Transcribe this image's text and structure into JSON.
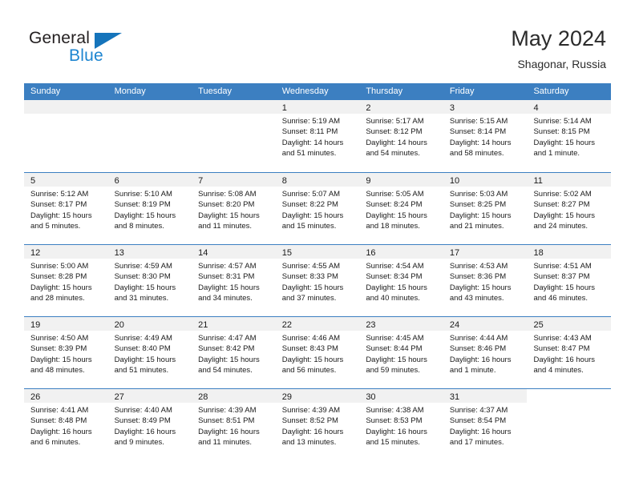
{
  "brand": {
    "name_dark": "General",
    "name_blue": "Blue",
    "accent_blue": "#1d85d0",
    "triangle_blue": "#1574bb"
  },
  "header": {
    "title": "May 2024",
    "subtitle": "Shagonar, Russia"
  },
  "calendar": {
    "header_bg": "#3c7fc1",
    "daynum_bg": "#f1f1f1",
    "weekdays": [
      "Sunday",
      "Monday",
      "Tuesday",
      "Wednesday",
      "Thursday",
      "Friday",
      "Saturday"
    ],
    "weeks": [
      [
        {
          "day": "",
          "blank": true
        },
        {
          "day": "",
          "blank": true
        },
        {
          "day": "",
          "blank": true
        },
        {
          "day": "1",
          "sunrise": "Sunrise: 5:19 AM",
          "sunset": "Sunset: 8:11 PM",
          "daylight": "Daylight: 14 hours and 51 minutes."
        },
        {
          "day": "2",
          "sunrise": "Sunrise: 5:17 AM",
          "sunset": "Sunset: 8:12 PM",
          "daylight": "Daylight: 14 hours and 54 minutes."
        },
        {
          "day": "3",
          "sunrise": "Sunrise: 5:15 AM",
          "sunset": "Sunset: 8:14 PM",
          "daylight": "Daylight: 14 hours and 58 minutes."
        },
        {
          "day": "4",
          "sunrise": "Sunrise: 5:14 AM",
          "sunset": "Sunset: 8:15 PM",
          "daylight": "Daylight: 15 hours and 1 minute."
        }
      ],
      [
        {
          "day": "5",
          "sunrise": "Sunrise: 5:12 AM",
          "sunset": "Sunset: 8:17 PM",
          "daylight": "Daylight: 15 hours and 5 minutes."
        },
        {
          "day": "6",
          "sunrise": "Sunrise: 5:10 AM",
          "sunset": "Sunset: 8:19 PM",
          "daylight": "Daylight: 15 hours and 8 minutes."
        },
        {
          "day": "7",
          "sunrise": "Sunrise: 5:08 AM",
          "sunset": "Sunset: 8:20 PM",
          "daylight": "Daylight: 15 hours and 11 minutes."
        },
        {
          "day": "8",
          "sunrise": "Sunrise: 5:07 AM",
          "sunset": "Sunset: 8:22 PM",
          "daylight": "Daylight: 15 hours and 15 minutes."
        },
        {
          "day": "9",
          "sunrise": "Sunrise: 5:05 AM",
          "sunset": "Sunset: 8:24 PM",
          "daylight": "Daylight: 15 hours and 18 minutes."
        },
        {
          "day": "10",
          "sunrise": "Sunrise: 5:03 AM",
          "sunset": "Sunset: 8:25 PM",
          "daylight": "Daylight: 15 hours and 21 minutes."
        },
        {
          "day": "11",
          "sunrise": "Sunrise: 5:02 AM",
          "sunset": "Sunset: 8:27 PM",
          "daylight": "Daylight: 15 hours and 24 minutes."
        }
      ],
      [
        {
          "day": "12",
          "sunrise": "Sunrise: 5:00 AM",
          "sunset": "Sunset: 8:28 PM",
          "daylight": "Daylight: 15 hours and 28 minutes."
        },
        {
          "day": "13",
          "sunrise": "Sunrise: 4:59 AM",
          "sunset": "Sunset: 8:30 PM",
          "daylight": "Daylight: 15 hours and 31 minutes."
        },
        {
          "day": "14",
          "sunrise": "Sunrise: 4:57 AM",
          "sunset": "Sunset: 8:31 PM",
          "daylight": "Daylight: 15 hours and 34 minutes."
        },
        {
          "day": "15",
          "sunrise": "Sunrise: 4:55 AM",
          "sunset": "Sunset: 8:33 PM",
          "daylight": "Daylight: 15 hours and 37 minutes."
        },
        {
          "day": "16",
          "sunrise": "Sunrise: 4:54 AM",
          "sunset": "Sunset: 8:34 PM",
          "daylight": "Daylight: 15 hours and 40 minutes."
        },
        {
          "day": "17",
          "sunrise": "Sunrise: 4:53 AM",
          "sunset": "Sunset: 8:36 PM",
          "daylight": "Daylight: 15 hours and 43 minutes."
        },
        {
          "day": "18",
          "sunrise": "Sunrise: 4:51 AM",
          "sunset": "Sunset: 8:37 PM",
          "daylight": "Daylight: 15 hours and 46 minutes."
        }
      ],
      [
        {
          "day": "19",
          "sunrise": "Sunrise: 4:50 AM",
          "sunset": "Sunset: 8:39 PM",
          "daylight": "Daylight: 15 hours and 48 minutes."
        },
        {
          "day": "20",
          "sunrise": "Sunrise: 4:49 AM",
          "sunset": "Sunset: 8:40 PM",
          "daylight": "Daylight: 15 hours and 51 minutes."
        },
        {
          "day": "21",
          "sunrise": "Sunrise: 4:47 AM",
          "sunset": "Sunset: 8:42 PM",
          "daylight": "Daylight: 15 hours and 54 minutes."
        },
        {
          "day": "22",
          "sunrise": "Sunrise: 4:46 AM",
          "sunset": "Sunset: 8:43 PM",
          "daylight": "Daylight: 15 hours and 56 minutes."
        },
        {
          "day": "23",
          "sunrise": "Sunrise: 4:45 AM",
          "sunset": "Sunset: 8:44 PM",
          "daylight": "Daylight: 15 hours and 59 minutes."
        },
        {
          "day": "24",
          "sunrise": "Sunrise: 4:44 AM",
          "sunset": "Sunset: 8:46 PM",
          "daylight": "Daylight: 16 hours and 1 minute."
        },
        {
          "day": "25",
          "sunrise": "Sunrise: 4:43 AM",
          "sunset": "Sunset: 8:47 PM",
          "daylight": "Daylight: 16 hours and 4 minutes."
        }
      ],
      [
        {
          "day": "26",
          "sunrise": "Sunrise: 4:41 AM",
          "sunset": "Sunset: 8:48 PM",
          "daylight": "Daylight: 16 hours and 6 minutes."
        },
        {
          "day": "27",
          "sunrise": "Sunrise: 4:40 AM",
          "sunset": "Sunset: 8:49 PM",
          "daylight": "Daylight: 16 hours and 9 minutes."
        },
        {
          "day": "28",
          "sunrise": "Sunrise: 4:39 AM",
          "sunset": "Sunset: 8:51 PM",
          "daylight": "Daylight: 16 hours and 11 minutes."
        },
        {
          "day": "29",
          "sunrise": "Sunrise: 4:39 AM",
          "sunset": "Sunset: 8:52 PM",
          "daylight": "Daylight: 16 hours and 13 minutes."
        },
        {
          "day": "30",
          "sunrise": "Sunrise: 4:38 AM",
          "sunset": "Sunset: 8:53 PM",
          "daylight": "Daylight: 16 hours and 15 minutes."
        },
        {
          "day": "31",
          "sunrise": "Sunrise: 4:37 AM",
          "sunset": "Sunset: 8:54 PM",
          "daylight": "Daylight: 16 hours and 17 minutes."
        },
        {
          "day": "",
          "blank": true,
          "nostrip": true
        }
      ]
    ]
  }
}
